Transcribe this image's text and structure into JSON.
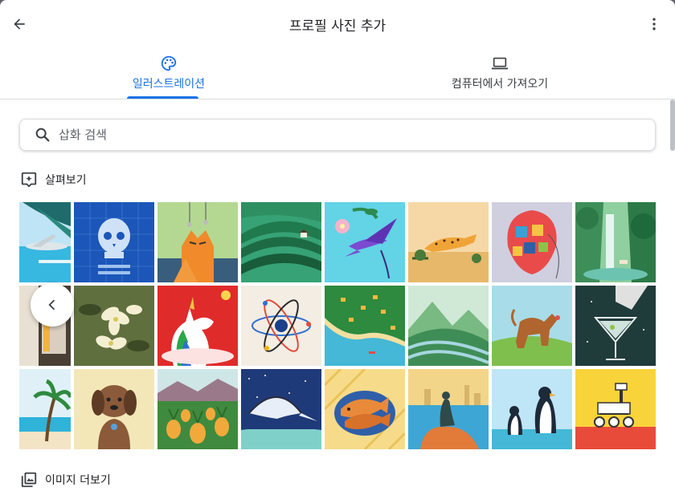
{
  "header": {
    "title": "프로필 사진 추가"
  },
  "tabs": [
    {
      "label": "일러스트레이션",
      "active": true
    },
    {
      "label": "컴퓨터에서 가져오기",
      "active": false
    }
  ],
  "search": {
    "placeholder": "삽화 검색"
  },
  "explore": {
    "label": "살펴보기"
  },
  "more_images": {
    "label": "이미지 더보기"
  },
  "illustrations": [
    "beach-airplane",
    "skeleton-xray",
    "orange-cat",
    "rice-terraces",
    "hummingbird-flower",
    "running-cheetah",
    "quilt-balloon",
    "waterfall-forest",
    "partial-frame",
    "magnolia-flowers",
    "unicorn",
    "atom",
    "coastal-town-map",
    "green-valley",
    "dog-playing",
    "martini-glass",
    "palm-beach",
    "puppy",
    "pineapple-field",
    "manta-ray",
    "taiyaki-fish-bread",
    "little-mermaid-statue",
    "penguins",
    "mars-rover"
  ],
  "colors": {
    "accent": "#1a73e8",
    "divider": "#dadce0",
    "text": "#202124",
    "icon": "#5f6368"
  }
}
